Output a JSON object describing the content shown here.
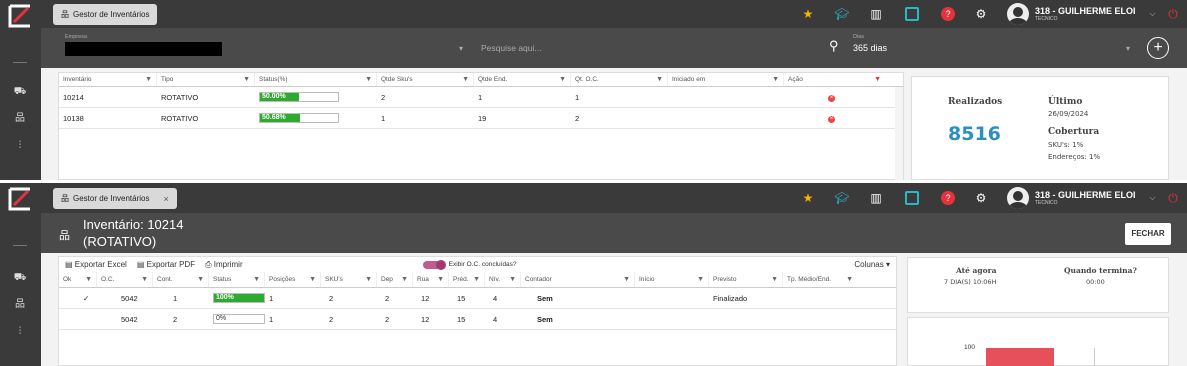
{
  "shot1": {
    "tab_title": "Gestor de Inventários",
    "user": {
      "name": "318 - GUILHERME ELOI",
      "role": "TECNICO"
    },
    "filter": {
      "empresa_label": "Empresa",
      "search_placeholder": "Pesquise aqui...",
      "dias_label": "Dias",
      "dias_value": "365 dias"
    },
    "table": {
      "headers": [
        "Inventário",
        "Tipo",
        "Status(%)",
        "Qtde Sku's",
        "Qtde End.",
        "Qt. O.C.",
        "Iniciado em",
        "Ação"
      ],
      "rows": [
        {
          "inventario": "10214",
          "tipo": "ROTATIVO",
          "status": "50.00%",
          "status_fill": 0.5,
          "skus": "2",
          "end": "1",
          "oc": "1",
          "iniciado": ""
        },
        {
          "inventario": "10138",
          "tipo": "ROTATIVO",
          "status": "50.68%",
          "status_fill": 0.5068,
          "skus": "1",
          "end": "19",
          "oc": "2",
          "iniciado": ""
        }
      ]
    },
    "card": {
      "realizados_label": "Realizados",
      "realizados_value": "8516",
      "ultimo_label": "Último",
      "ultimo_value": "26/09/2024",
      "cobertura_label": "Cobertura",
      "skus_line": "SKU's: 1%",
      "end_line": "Endereços: 1%"
    }
  },
  "shot2": {
    "tab_title": "Gestor de Inventários",
    "tab_close": "×",
    "user": {
      "name": "318 - GUILHERME ELOI",
      "role": "TECNICO"
    },
    "title_line1": "Inventário: 10214",
    "title_line2": "(ROTATIVO)",
    "fechar": "FECHAR",
    "toolbar": {
      "excel": "Exportar Excel",
      "pdf": "Exportar PDF",
      "print": "Imprimir",
      "toggle_label": "Exibir O.C. concluídas?",
      "colunas": "Colunas"
    },
    "table": {
      "headers": [
        "Ok",
        "O.C.",
        "Cont.",
        "Status",
        "Posições",
        "SKU's",
        "Dep",
        "Rua",
        "Préd.",
        "Nív.",
        "Contador",
        "Início",
        "Previsto",
        "Tp. Médio/End."
      ],
      "rows": [
        {
          "ok": "✓",
          "oc": "5042",
          "cont": "1",
          "status": "100%",
          "status_fill": 1.0,
          "pos": "1",
          "skus": "2",
          "dep": "2",
          "rua": "12",
          "pred": "15",
          "niv": "4",
          "contador": "Sem",
          "inicio": "",
          "previsto": "Finalizado",
          "tp": ""
        },
        {
          "ok": "",
          "oc": "5042",
          "cont": "2",
          "status": "0%",
          "status_fill": 0.0,
          "pos": "1",
          "skus": "2",
          "dep": "2",
          "rua": "12",
          "pred": "15",
          "niv": "4",
          "contador": "Sem",
          "inicio": "",
          "previsto": "",
          "tp": ""
        }
      ]
    },
    "card": {
      "ate_agora_label": "Até agora",
      "ate_agora_value": "7 DIA(S) 10:06H",
      "quando_label": "Quando termina?",
      "quando_value": "00:00",
      "chart_tick": "100"
    }
  },
  "colors": {
    "sidebar": "#3a3a3a",
    "accent_red": "#e6323c",
    "star": "#f4b400",
    "teal": "#2ab7c7",
    "green": "#2eaa2e",
    "highlight_blue": "#2b8fc0"
  }
}
